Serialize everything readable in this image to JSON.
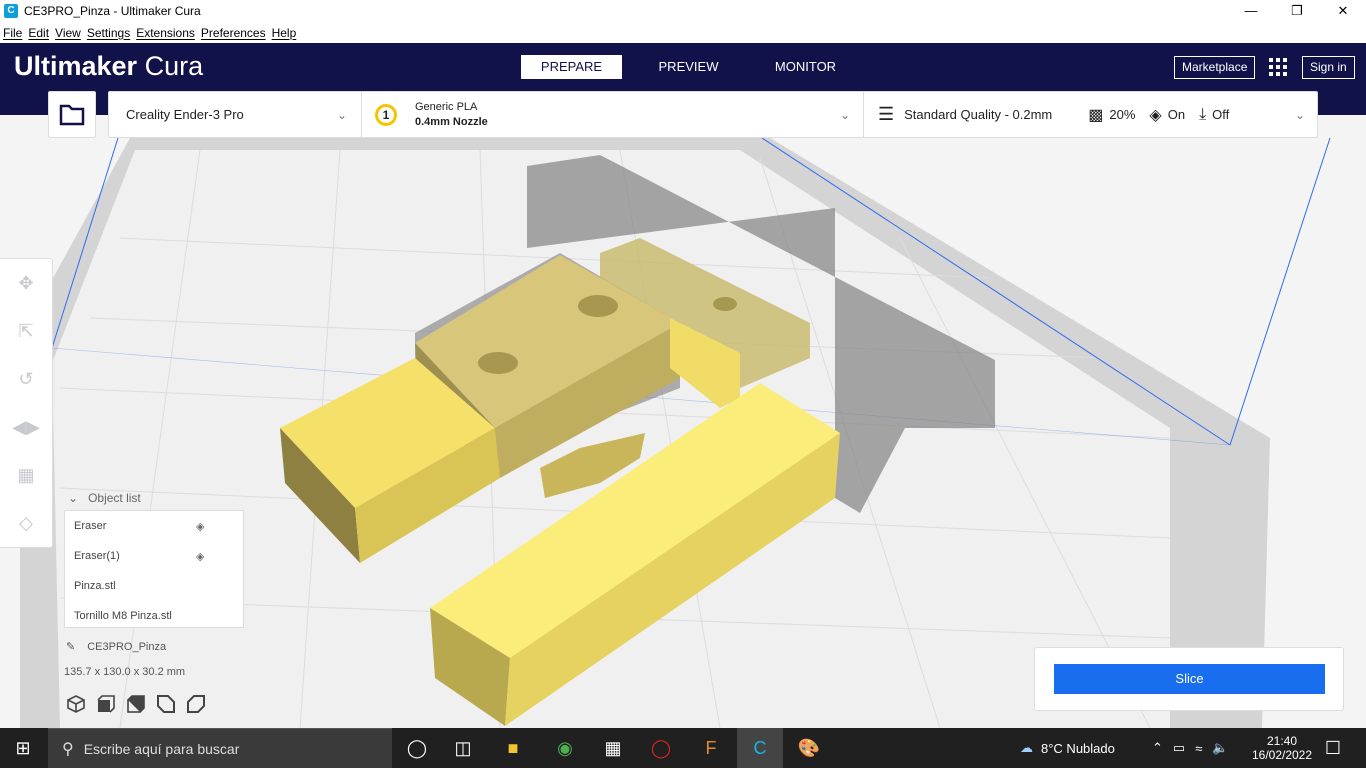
{
  "window": {
    "title": "CE3PRO_Pinza - Ultimaker Cura",
    "app_icon": "C"
  },
  "menu": [
    "File",
    "Edit",
    "View",
    "Settings",
    "Extensions",
    "Preferences",
    "Help"
  ],
  "header": {
    "brand_bold": "Ultimaker",
    "brand_light": "Cura",
    "tabs": [
      "PREPARE",
      "PREVIEW",
      "MONITOR"
    ],
    "active_tab": "PREPARE",
    "marketplace": "Marketplace",
    "signin": "Sign in"
  },
  "toolbar": {
    "printer": "Creality Ender-3 Pro",
    "extruder_number": "1",
    "material": "Generic PLA",
    "nozzle": "0.4mm Nozzle",
    "quality": "Standard Quality - 0.2mm",
    "infill": "20%",
    "support": "On",
    "adhesion": "Off"
  },
  "object_list": {
    "title": "Object list",
    "items": [
      {
        "name": "Eraser",
        "eraser": true
      },
      {
        "name": "Eraser(1)",
        "eraser": true
      },
      {
        "name": "Pinza.stl",
        "eraser": false
      },
      {
        "name": "Tornillo M8 Pinza.stl",
        "eraser": false
      }
    ]
  },
  "job": {
    "name": "CE3PRO_Pinza",
    "dimensions": "135.7 x 130.0 x 30.2 mm"
  },
  "slice": {
    "label": "Slice"
  },
  "colors": {
    "accent": "#196ef0",
    "header": "#12124a",
    "model": "#f7e36a"
  },
  "taskbar": {
    "search_placeholder": "Escribe aquí para buscar",
    "weather": "8°C  Nublado",
    "time": "21:40",
    "date": "16/02/2022"
  }
}
